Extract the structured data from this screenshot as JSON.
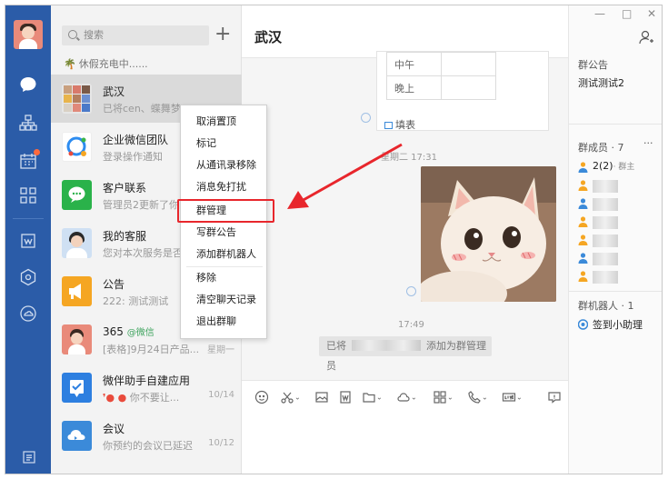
{
  "search": {
    "placeholder": "搜索"
  },
  "status_text": "休假充电中......",
  "chats": [
    {
      "name": "武汉",
      "preview": "已将cen、蝶舞梦...",
      "time": "",
      "selected": true
    },
    {
      "name": "企业微信团队",
      "preview": "登录操作通知",
      "time": ""
    },
    {
      "name": "客户联系",
      "preview": "管理员2更新了你的",
      "time": ""
    },
    {
      "name": "我的客服",
      "preview": "您对本次服务是否满",
      "time": ""
    },
    {
      "name": "公告",
      "preview": "222: 测试测试",
      "time": ""
    },
    {
      "name": "365",
      "tag": "@微信",
      "preview": "[表格]9月24日产品...",
      "time": "星期一"
    },
    {
      "name": "微伴助手自建应用",
      "preview": "你不要让...",
      "time": "10/14"
    },
    {
      "name": "会议",
      "preview": "你预约的会议已延迟",
      "time": "10/12"
    }
  ],
  "chat": {
    "title": "武汉",
    "card_rows": [
      "中午",
      "晚上"
    ],
    "card_fill": "填表",
    "timestamp1": "星期二 17:31",
    "timestamp2": "17:49",
    "notice_prefix": "已将",
    "notice_suffix": "添加为群管理员"
  },
  "context_menu": [
    "取消置顶",
    "标记",
    "从通讯录移除",
    "消息免打扰",
    "群管理",
    "写群公告",
    "添加群机器人",
    "移除",
    "清空聊天记录",
    "退出群聊"
  ],
  "highlighted_item": "群管理",
  "window": {
    "minimize": "—",
    "maximize": "□",
    "close": "✕"
  },
  "panel": {
    "announcement_title": "群公告",
    "announcement_text": "测试测试2",
    "members_title": "群成员 · 7",
    "members_more": "···",
    "owner": "2(2)",
    "owner_tag": "· 群主",
    "robots_title": "群机器人 · 1",
    "robot_name": "签到小助理"
  },
  "colors": {
    "nav_bg": "#2b5ca8",
    "highlight": "#e8262c",
    "accent": "#3b8ad9"
  }
}
